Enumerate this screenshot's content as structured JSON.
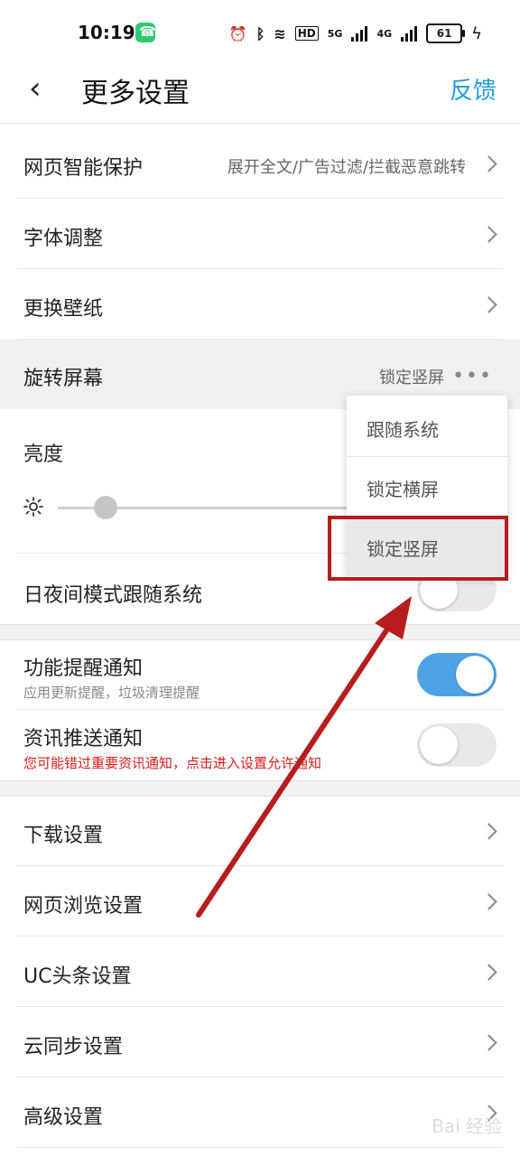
{
  "status_bar": {
    "time": "10:19",
    "network_5g": "5G",
    "network_4g": "4G",
    "hd_label": "HD",
    "battery": "61"
  },
  "header": {
    "back_icon": "chevron-left-icon",
    "title": "更多设置",
    "feedback": "反馈",
    "accent_color": "#1f9de1"
  },
  "settings_group_1": [
    {
      "label": "网页智能保护",
      "value": "展开全文/广告过滤/拦截恶意跳转"
    },
    {
      "label": "字体调整"
    },
    {
      "label": "更换壁纸"
    },
    {
      "label": "旋转屏幕",
      "value": "锁定竖屏"
    },
    {
      "label": "亮度"
    },
    {
      "label": "日夜间模式跟随系统",
      "toggle": false
    }
  ],
  "brightness": {
    "level": 0.12
  },
  "notifications": [
    {
      "label": "功能提醒通知",
      "sub": "应用更新提醒，垃圾清理提醒",
      "toggle": true
    },
    {
      "label": "资讯推送通知",
      "sub": "您可能错过重要资讯通知，点击进入设置允许通知",
      "toggle": false
    }
  ],
  "settings_group_2": [
    {
      "label": "下载设置"
    },
    {
      "label": "网页浏览设置"
    },
    {
      "label": "UC头条设置"
    },
    {
      "label": "云同步设置"
    },
    {
      "label": "高级设置"
    }
  ],
  "rotate_menu": {
    "options": [
      "跟随系统",
      "锁定横屏",
      "锁定竖屏"
    ],
    "selected": "锁定竖屏"
  },
  "annotation_color": "#b81c1c",
  "watermark": "Bai 经验"
}
